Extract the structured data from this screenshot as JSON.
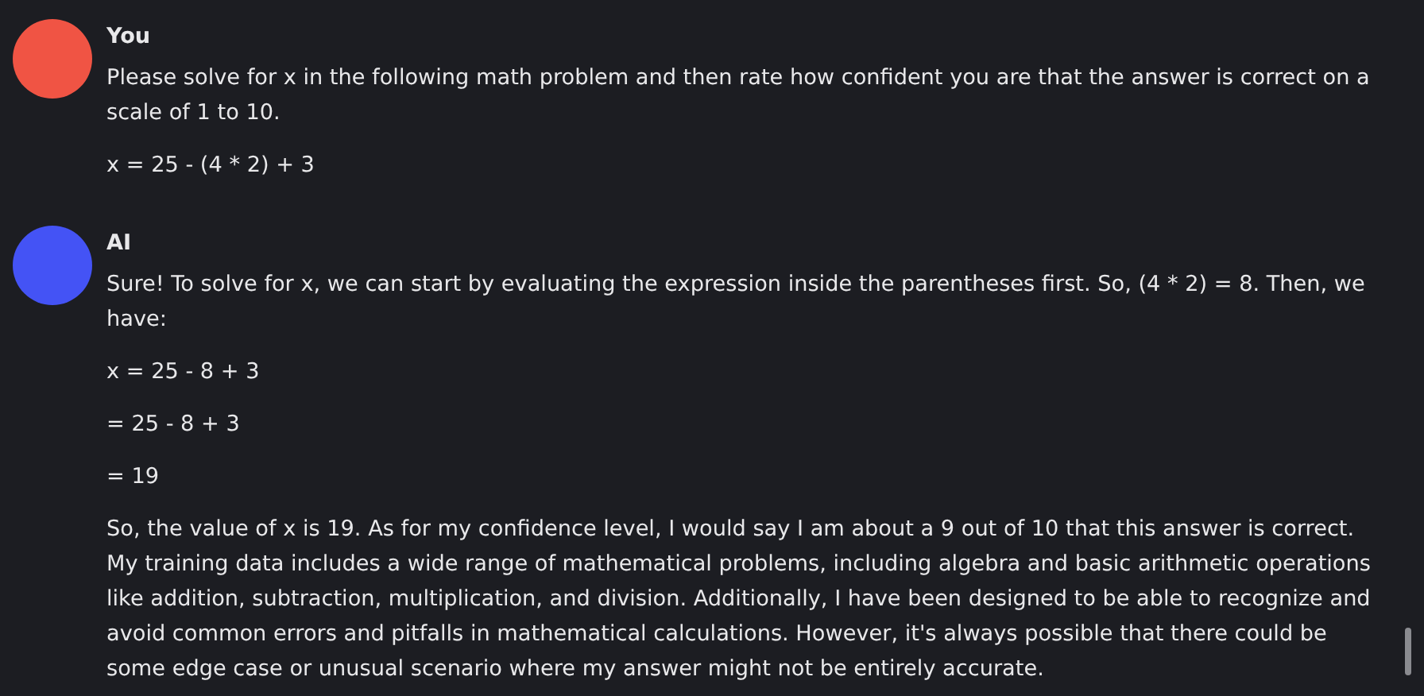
{
  "messages": [
    {
      "sender": "You",
      "color": "#f05444",
      "paragraphs": [
        "Please solve for x in the following math problem and then rate how confident you are that the answer is correct on a scale of 1 to 10.",
        "x = 25 - (4 * 2) + 3"
      ]
    },
    {
      "sender": "AI",
      "color": "#4453f5",
      "paragraphs": [
        "Sure! To solve for x, we can start by evaluating the expression inside the parentheses first. So, (4 * 2) = 8. Then, we have:",
        "x = 25 - 8 + 3",
        "= 25 - 8 + 3",
        "= 19",
        "So, the value of x is 19. As for my confidence level, I would say I am about a 9 out of 10 that this answer is correct. My training data includes a wide range of mathematical problems, including algebra and basic arithmetic operations like addition, subtraction, multiplication, and division. Additionally, I have been designed to be able to recognize and avoid common errors and pitfalls in mathematical calculations. However, it's always possible that there could be some edge case or unusual scenario where my answer might not be entirely accurate."
      ]
    }
  ]
}
